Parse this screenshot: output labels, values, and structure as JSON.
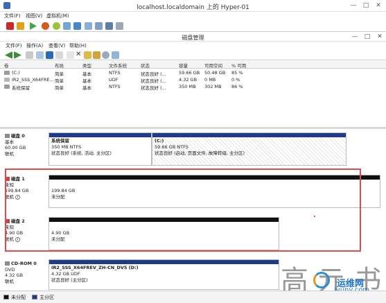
{
  "hyperv": {
    "title": "localhost.localdomain 上的 Hyper-01",
    "menu": [
      "文件(F)",
      "视图(V)",
      "虚拟机(M)"
    ]
  },
  "diskmgmt": {
    "title": "磁盘管理",
    "menu": [
      "文件(F)",
      "操作(A)",
      "查看(V)",
      "帮助(H)"
    ]
  },
  "volumes": {
    "headers": [
      "卷",
      "布局",
      "类型",
      "文件系统",
      "状态",
      "容量",
      "可用空间",
      "% 可用"
    ],
    "rows": [
      [
        "(C:)",
        "简单",
        "基本",
        "NTFS",
        "状态良好 (...",
        "59.66 GB",
        "50.48 GB",
        "85 %"
      ],
      [
        "IR2_SSS_X64FRE...",
        "简单",
        "基本",
        "UDF",
        "状态良好 (...",
        "4.32 GB",
        "0 MB",
        "0 %"
      ],
      [
        "系统保留",
        "简单",
        "基本",
        "NTFS",
        "状态良好 (...",
        "350 MB",
        "302 MB",
        "86 %"
      ]
    ]
  },
  "disks": [
    {
      "name": "磁盘 0",
      "type": "基本",
      "size": "60.00 GB",
      "state": "联机",
      "partitions": [
        {
          "name": "系统保留",
          "detail": "350 MB NTFS",
          "status": "状态良好 (系统, 活动, 主分区)"
        },
        {
          "name": "(C:)",
          "detail": "59.66 GB NTFS",
          "status": "状态良好 (启动, 页面文件, 故障转储, 主分区)"
        }
      ]
    },
    {
      "name": "磁盘 1",
      "type": "未知",
      "size": "199.84 GB",
      "state": "脱机",
      "partitions": [
        {
          "detail": "199.84 GB",
          "status": "未分配"
        }
      ]
    },
    {
      "name": "磁盘 2",
      "type": "未知",
      "size": "4.90 GB",
      "state": "脱机",
      "partitions": [
        {
          "detail": "4.90 GB",
          "status": "未分配"
        }
      ]
    },
    {
      "name": "CD-ROM 0",
      "type": "DVD",
      "size": "4.32 GB",
      "state": "联机",
      "partitions": [
        {
          "name": "IR2_SSS_X64FREV_ZH-CN_DV5 (D:)",
          "detail": "4.32 GB UDF",
          "status": "状态良好 (主分区)"
        }
      ]
    }
  ],
  "legend": [
    "未分配",
    "主分区"
  ],
  "watermark": {
    "chars": "高 亓 书",
    "site": "iyunv.com",
    "brand": "运维网"
  },
  "colors": {
    "primary_bar": "#1d3b8a",
    "unallocated_bar": "#111111",
    "highlight": "#e14b4b"
  }
}
